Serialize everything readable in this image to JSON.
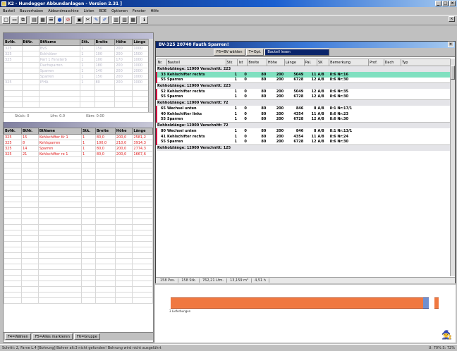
{
  "window": {
    "title": "K2 - Hundegger Abbundanlagen - Version 2.31 ]",
    "controls": [
      "_",
      "□",
      "×"
    ]
  },
  "menu": [
    "Basteil",
    "Bauvorhaben",
    "Abbundmaschine",
    "Listen",
    "BDE",
    "Optionen",
    "Fenster",
    "Hilfe"
  ],
  "toolbar": {
    "icons": [
      "new-icon",
      "open-icon",
      "copy-icon",
      "print-icon",
      "save-icon",
      "list-icon",
      "globe-icon",
      "stop-icon",
      "window-icon",
      "cut-icon",
      "edit-icon",
      "edit2-icon",
      "grid-icon",
      "grid2-icon",
      "table-icon",
      "info-icon"
    ]
  },
  "left_top": {
    "title": "",
    "columns": [
      "BvNr.",
      "BtNr.",
      "BtName",
      "Stk.",
      "Breite",
      "Höhe",
      "Länge"
    ],
    "rows": [
      [
        "325",
        "",
        "BvS",
        "1",
        "150",
        "200",
        "1000"
      ],
      [
        "325",
        "",
        "Eckhölzer",
        "1",
        "100",
        "200",
        "1500"
      ],
      [
        "325",
        "",
        "Part 1 Fensterb",
        "1",
        "100",
        "170",
        "1000"
      ],
      [
        "",
        "",
        "Dachsparren",
        "1",
        "180",
        "200",
        "1000"
      ],
      [
        "",
        "",
        "Sparren",
        "1",
        "140",
        "200",
        "2000"
      ],
      [
        "",
        "",
        "Sparren",
        "1",
        "150",
        "200",
        "1000"
      ],
      [
        "325",
        "",
        "IFHA",
        "1",
        "80",
        "200",
        "1000"
      ]
    ],
    "status": {
      "stueck": "Stück: 0",
      "lfm": "Lfm: 0.0",
      "kbm": "Kbm: 0.00"
    }
  },
  "left_bottom": {
    "title": "",
    "columns": [
      "BvNr.",
      "BtNr.",
      "BtName",
      "Stk.",
      "Breite",
      "Höhe",
      "Länge"
    ],
    "rows": [
      [
        "325",
        "15",
        "Kehlschifter Kr 1",
        "1",
        "80,0",
        "200,0",
        "2581,2"
      ],
      [
        "325",
        "8",
        "Kehlsparren",
        "1",
        "100,0",
        "210,0",
        "3914,3"
      ],
      [
        "325",
        "14",
        "Sparren",
        "1",
        "80,0",
        "200,0",
        "2774,3"
      ],
      [
        "325",
        "21",
        "Kehlschifter re 1",
        "1",
        "80,0",
        "200,0",
        "1667,6"
      ]
    ],
    "tabs": [
      "F4=Wählen",
      "F5=Alles markieren",
      "F6=Gruppe"
    ]
  },
  "right": {
    "title": "BV-325 20740 Fauth Sparren!",
    "toolbar": [
      "F6=BV wählen",
      "T=Opt.",
      "Bauteil lesen"
    ],
    "columns": [
      "Nr.",
      "Bauteil",
      "Stk",
      "Ist",
      "Breite",
      "Höhe",
      "Länge",
      "Pal.",
      "SK",
      "Bemerkung",
      "Prof.",
      "Dach",
      "Typ"
    ],
    "groups": [
      {
        "header": "Rohholzlänge: 12000 Verschnitt: 223",
        "items": [
          {
            "nr": "33",
            "name": "Kehlschifter rechts",
            "stk": "1",
            "ist": "0",
            "b": "80",
            "h": "200",
            "l": "5049",
            "pal": "11",
            "sk": "A/8",
            "bem": "8:6 Nr:16",
            "hl": true
          },
          {
            "nr": "55",
            "name": "Sparren",
            "stk": "1",
            "ist": "0",
            "b": "80",
            "h": "200",
            "l": "6728",
            "pal": "12",
            "sk": "A/8",
            "bem": "8:6 Nr:30",
            "hl": false
          }
        ]
      },
      {
        "header": "Rohholzlänge: 12000 Verschnitt: 223",
        "items": [
          {
            "nr": "52",
            "name": "Kehlschifter rechts",
            "stk": "1",
            "ist": "0",
            "b": "80",
            "h": "200",
            "l": "5049",
            "pal": "12",
            "sk": "A/8",
            "bem": "8:6 Nr:35",
            "hl": false
          },
          {
            "nr": "55",
            "name": "Sparren",
            "stk": "1",
            "ist": "0",
            "b": "80",
            "h": "200",
            "l": "6728",
            "pal": "12",
            "sk": "A/8",
            "bem": "8:6 Nr:30",
            "hl": false
          }
        ]
      },
      {
        "header": "Rohholzlänge: 12000 Verschnitt: 72",
        "items": [
          {
            "nr": "65",
            "name": "Wechsel unten",
            "stk": "1",
            "ist": "0",
            "b": "80",
            "h": "200",
            "l": "846",
            "pal": "8",
            "sk": "A/8",
            "bem": "8:1 Nr:17/1",
            "hl": false
          },
          {
            "nr": "40",
            "name": "Kehlschifter links",
            "stk": "1",
            "ist": "0",
            "b": "80",
            "h": "200",
            "l": "4354",
            "pal": "11",
            "sk": "A/8",
            "bem": "8:6 Nr:23",
            "hl": false
          },
          {
            "nr": "55",
            "name": "Sparren",
            "stk": "1",
            "ist": "0",
            "b": "80",
            "h": "200",
            "l": "6728",
            "pal": "12",
            "sk": "A/8",
            "bem": "8:6 Nr:30",
            "hl": false
          }
        ]
      },
      {
        "header": "Rohholzlänge: 12000 Verschnitt: 72",
        "items": [
          {
            "nr": "80",
            "name": "Wechsel unten",
            "stk": "1",
            "ist": "0",
            "b": "80",
            "h": "200",
            "l": "846",
            "pal": "8",
            "sk": "A/8",
            "bem": "8:1 Nr:13/1",
            "hl": false
          },
          {
            "nr": "41",
            "name": "Kehlschifter rechts",
            "stk": "1",
            "ist": "0",
            "b": "80",
            "h": "200",
            "l": "4354",
            "pal": "11",
            "sk": "A/8",
            "bem": "8:6 Nr:24",
            "hl": false
          },
          {
            "nr": "55",
            "name": "Sparren",
            "stk": "1",
            "ist": "0",
            "b": "80",
            "h": "200",
            "l": "6728",
            "pal": "12",
            "sk": "A/8",
            "bem": "8:6 Nr:30",
            "hl": false
          }
        ]
      },
      {
        "header": "Rohholzlänge: 12000 Verschnitt: 125",
        "items": []
      }
    ],
    "status": [
      "158 Pos.",
      "158 Stk.",
      "762,21 Lfm.",
      "13,159 m³",
      "4,51 h"
    ]
  },
  "beam": {
    "label": "3 Lieferbungen"
  },
  "statusbar": {
    "text": "Schritt: 2, Farve L.4 [Bohrung] Bohrer alt:3 nicht gefunden! Bohrung wird nicht ausgelührt",
    "zoom": "U: 70% S: 72%"
  }
}
